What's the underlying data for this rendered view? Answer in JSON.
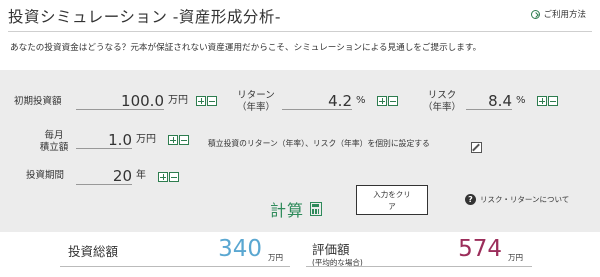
{
  "header": {
    "title": "投資シミュレーション -資産形成分析-",
    "help_link": "ご利用方法"
  },
  "intro": "あなたの投資資金はどうなる？元本が保証されない資産運用だからこそ、シミュレーションによる見通しをご提示します。",
  "inputs": {
    "initial": {
      "label": "初期投資額",
      "value": "100.0",
      "unit": "万円"
    },
    "return": {
      "label_line1": "リターン",
      "label_line2": "（年率）",
      "value": "4.2",
      "unit": "%"
    },
    "risk": {
      "label_line1": "リスク",
      "label_line2": "（年率）",
      "value": "8.4",
      "unit": "%"
    },
    "monthly": {
      "label_line1": "毎月",
      "label_line2": "積立額",
      "value": "1.0",
      "unit": "万円"
    },
    "period": {
      "label": "投資期間",
      "value": "20",
      "unit": "年"
    }
  },
  "note": "積立投資のリターン（年率）、リスク（年率）を個別に設定する",
  "buttons": {
    "calc": "計算",
    "clear_line1": "入力をクリ",
    "clear_line2": "ア",
    "risk_return_link": "リスク・リターンについて"
  },
  "results": {
    "total_invest": {
      "label": "投資総額",
      "value": "340",
      "unit": "万円"
    },
    "valuation": {
      "label": "評価額",
      "sub": "(平均的な場合)",
      "value": "574",
      "unit": "万円"
    }
  },
  "colors": {
    "accent_green": "#2e8a5a",
    "value_blue": "#5aa7d1",
    "value_red": "#9b2d5a",
    "panel_bg": "#ececec"
  }
}
